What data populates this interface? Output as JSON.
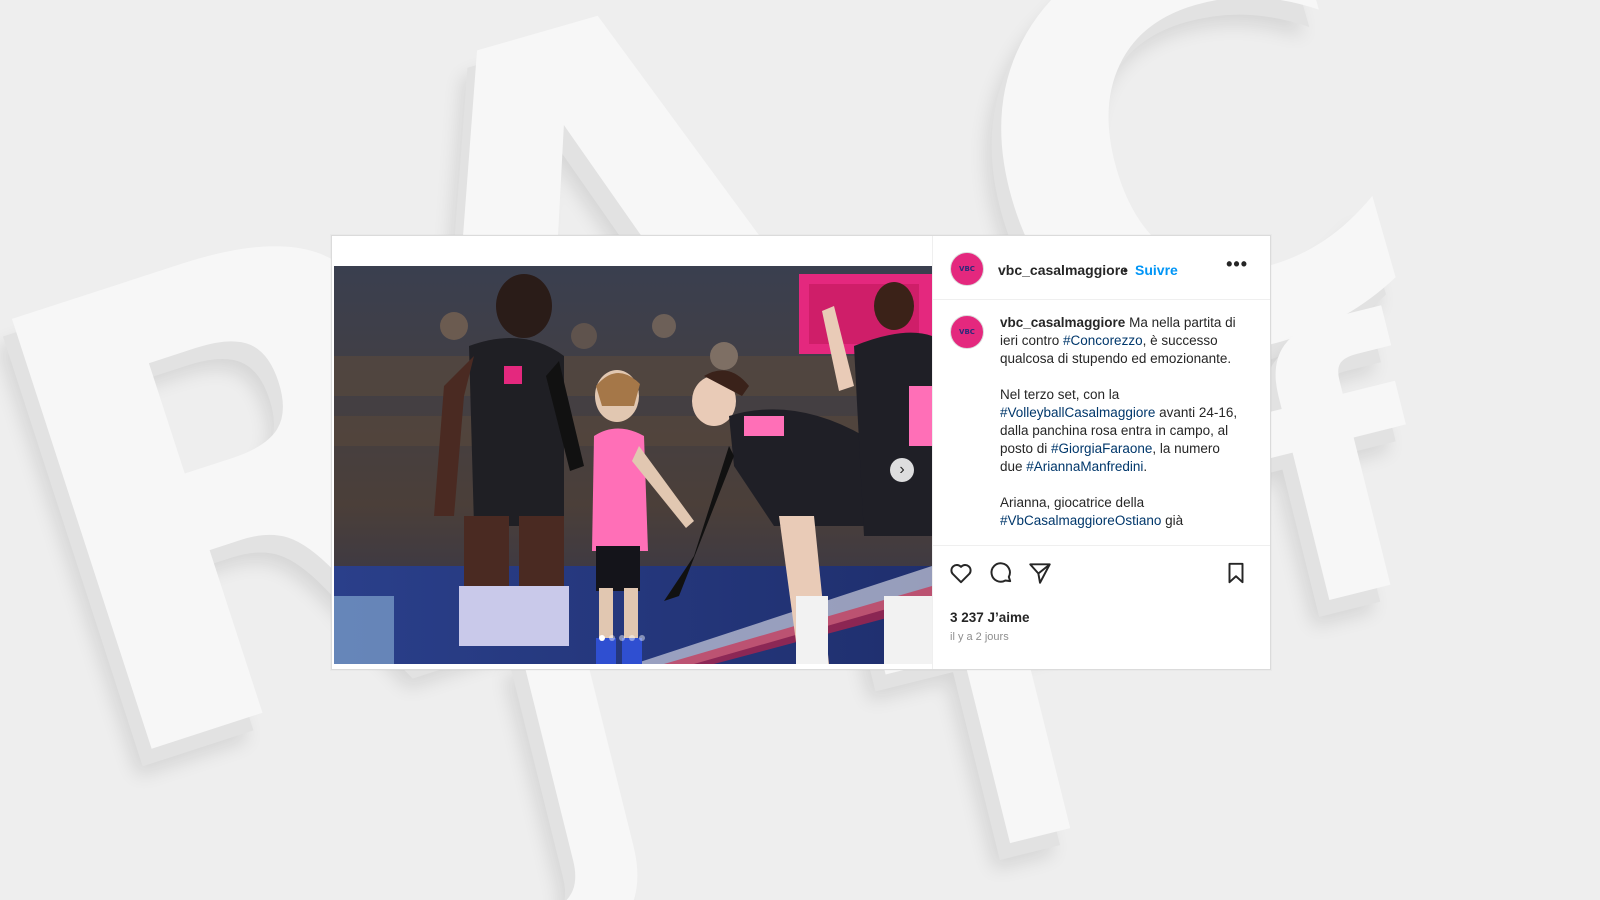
{
  "background": {
    "letters": [
      "R",
      "A",
      "C",
      "f",
      "J",
      "T"
    ]
  },
  "post": {
    "username": "vbc_casalmaggiore",
    "dot": "•",
    "follow_label": "Suivre",
    "more_label": "•••",
    "avatar_text": "VBC",
    "photo": {
      "carousel_count": 5,
      "active_index": 0,
      "next_icon": "chevron-right-icon"
    },
    "caption": {
      "username": "vbc_casalmaggiore",
      "p1_a": " Ma nella partita di ieri contro ",
      "p1_tag": "#Concorezzo",
      "p1_b": ", è successo qualcosa di stupendo ed emozionante.",
      "p2_a": "Nel terzo set, con la ",
      "p2_tag1": "#VolleyballCasalmaggiore",
      "p2_b": " avanti 24-16, dalla panchina rosa entra in campo, al posto di ",
      "p2_tag2": "#GiorgiaFaraone",
      "p2_c": ", la numero due ",
      "p2_tag3": "#AriannaManfredini",
      "p2_d": ".",
      "p3_a": "Arianna, giocatrice della ",
      "p3_tag": "#VbCasalmaggioreOstiano",
      "p3_b": " già"
    },
    "actions": {
      "like_icon": "heart-icon",
      "comment_icon": "comment-icon",
      "share_icon": "send-icon",
      "save_icon": "bookmark-icon"
    },
    "likes": "3 237 J’aime",
    "time": "il y a 2 jours"
  },
  "colors": {
    "link": "#0095f6",
    "hashtag": "#00376b",
    "brand_pink": "#e4287e"
  }
}
